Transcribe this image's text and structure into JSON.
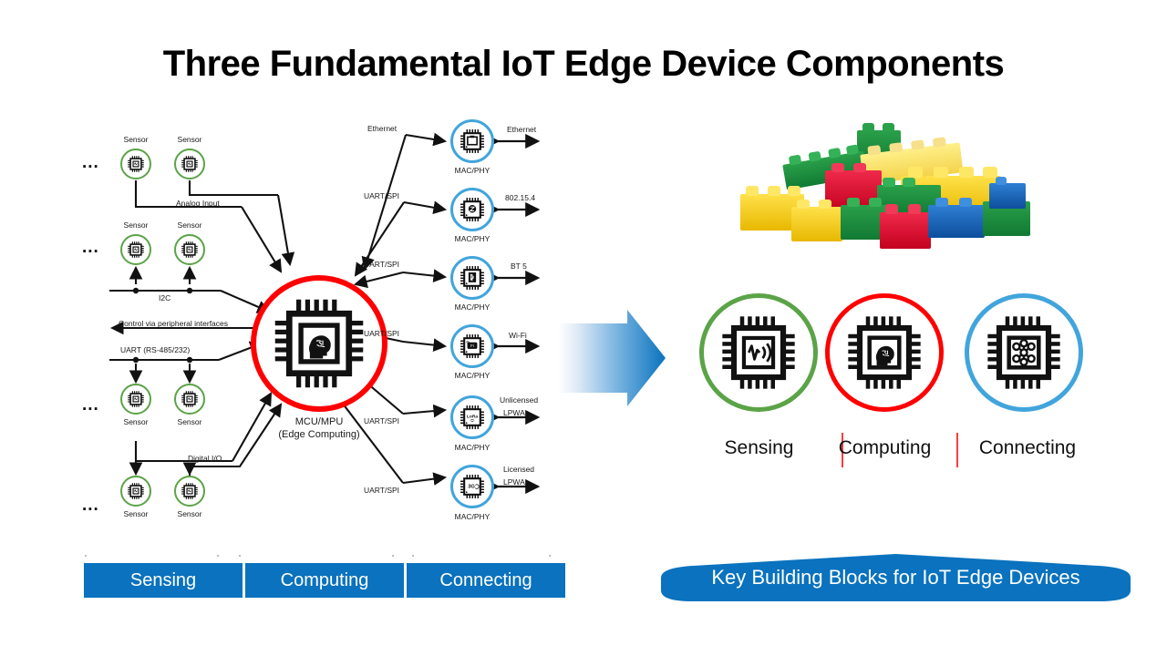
{
  "title": "Three Fundamental IoT Edge Device Components",
  "left_diagram": {
    "ellipsis": "...",
    "sensors": [
      {
        "label": "Sensor"
      },
      {
        "label": "Sensor"
      },
      {
        "label": "Sensor"
      },
      {
        "label": "Sensor"
      },
      {
        "label": "Sensor"
      },
      {
        "label": "Sensor"
      },
      {
        "label": "Sensor"
      },
      {
        "label": "Sensor"
      }
    ],
    "bus_labels": {
      "analog_input": "Analog Input",
      "i2c": "I2C",
      "control": "Control via peripheral interfaces",
      "uart_rs": "UART (RS-485/232)",
      "digital_io": "Digital I/O"
    },
    "mcu": {
      "line1": "MCU/MPU",
      "line2": "(Edge Computing)",
      "icon": "cpu-brain-icon"
    },
    "connectivity": [
      {
        "in_label": "Ethernet",
        "out_label": "Ethernet",
        "phy": "MAC/PHY",
        "icon": "ethernet-port-icon"
      },
      {
        "in_label": "UART/SPI",
        "out_label": "802.15.4",
        "phy": "MAC/PHY",
        "icon": "zigbee-icon"
      },
      {
        "in_label": "UART/SPI",
        "out_label": "BT 5",
        "phy": "MAC/PHY",
        "icon": "bluetooth-icon"
      },
      {
        "in_label": "UART/SPI",
        "out_label": "Wi-Fi",
        "phy": "MAC/PHY",
        "icon": "wifi-icon"
      },
      {
        "in_label": "UART/SPI",
        "out_label": "Unlicensed\nLPWA",
        "phy": "MAC/PHY",
        "icon": "lora-icon",
        "out_line1": "Unlicensed",
        "out_line2": "LPWA"
      },
      {
        "in_label": "UART/SPI",
        "out_label": "Licensed\nLPWA",
        "phy": "MAC/PHY",
        "icon": "3gpp-icon",
        "out_line1": "Licensed",
        "out_line2": "LPWA"
      }
    ]
  },
  "bottom_bar": {
    "segments": [
      "Sensing",
      "Computing",
      "Connecting"
    ],
    "color": "#0A72BE"
  },
  "arrow": {
    "name": "gradient-right-arrow",
    "color_from": "#FFFFFF",
    "color_to": "#0A72BE"
  },
  "lego": {
    "name": "lego-bricks-photo",
    "colors": [
      "#1E7A3C",
      "#F2C200",
      "#E3001B",
      "#0A59B0",
      "#F7DF5A"
    ]
  },
  "building_blocks": [
    {
      "label": "Sensing",
      "ring_color": "#5BA347",
      "icon": "chip-waveform-icon"
    },
    {
      "label": "Computing",
      "ring_color": "#FF0000",
      "icon": "chip-brain-icon"
    },
    {
      "label": "Connecting",
      "ring_color": "#41A5DC",
      "icon": "chip-network-icon"
    }
  ],
  "separator_color": "#FF3B3B",
  "banner": {
    "text": "Key Building Blocks for IoT Edge Devices",
    "color": "#0A72BE"
  }
}
